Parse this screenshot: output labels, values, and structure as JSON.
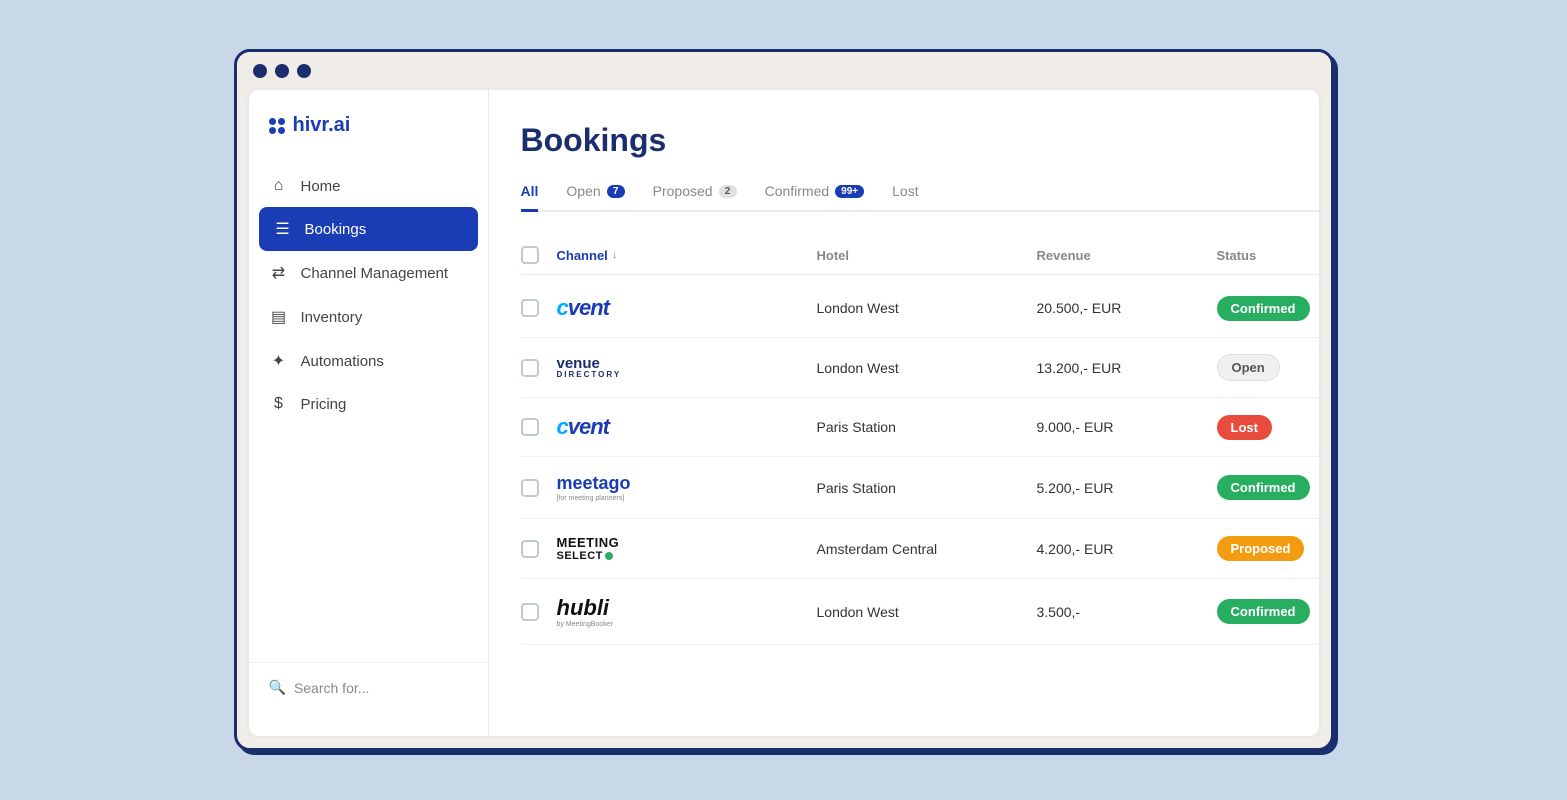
{
  "app": {
    "logo_text": "hivr.ai"
  },
  "sidebar": {
    "nav_items": [
      {
        "id": "home",
        "label": "Home",
        "icon": "home",
        "active": false
      },
      {
        "id": "bookings",
        "label": "Bookings",
        "icon": "bookings",
        "active": true
      },
      {
        "id": "channel-management",
        "label": "Channel Management",
        "icon": "channel",
        "active": false
      },
      {
        "id": "inventory",
        "label": "Inventory",
        "icon": "inventory",
        "active": false
      },
      {
        "id": "automations",
        "label": "Automations",
        "icon": "automations",
        "active": false
      },
      {
        "id": "pricing",
        "label": "Pricing",
        "icon": "pricing",
        "active": false
      }
    ],
    "search_placeholder": "Search for..."
  },
  "main": {
    "page_title": "Bookings",
    "tabs": [
      {
        "id": "all",
        "label": "All",
        "badge": null,
        "active": true
      },
      {
        "id": "open",
        "label": "Open",
        "badge": "7",
        "active": false
      },
      {
        "id": "proposed",
        "label": "Proposed",
        "badge": "2",
        "active": false
      },
      {
        "id": "confirmed",
        "label": "Confirmed",
        "badge": "99+",
        "active": false
      },
      {
        "id": "lost",
        "label": "Lost",
        "badge": null,
        "active": false
      }
    ],
    "table": {
      "columns": [
        {
          "id": "checkbox",
          "label": ""
        },
        {
          "id": "channel",
          "label": "Channel",
          "sortable": true
        },
        {
          "id": "hotel",
          "label": "Hotel"
        },
        {
          "id": "revenue",
          "label": "Revenue"
        },
        {
          "id": "status",
          "label": "Status"
        },
        {
          "id": "actions",
          "label": ""
        }
      ],
      "rows": [
        {
          "id": 1,
          "channel": "cvent",
          "channel_display": "cvent",
          "hotel": "London West",
          "revenue": "20.500,- EUR",
          "status": "Confirmed",
          "status_type": "confirmed"
        },
        {
          "id": 2,
          "channel": "venue-directory",
          "channel_display": "Venue Directory",
          "hotel": "London West",
          "revenue": "13.200,- EUR",
          "status": "Open",
          "status_type": "open"
        },
        {
          "id": 3,
          "channel": "cvent",
          "channel_display": "cvent",
          "hotel": "Paris Station",
          "revenue": "9.000,- EUR",
          "status": "Lost",
          "status_type": "lost"
        },
        {
          "id": 4,
          "channel": "meetago",
          "channel_display": "meetago",
          "hotel": "Paris Station",
          "revenue": "5.200,- EUR",
          "status": "Confirmed",
          "status_type": "confirmed"
        },
        {
          "id": 5,
          "channel": "meeting-select",
          "channel_display": "Meeting Select",
          "hotel": "Amsterdam Central",
          "revenue": "4.200,- EUR",
          "status": "Proposed",
          "status_type": "proposed"
        },
        {
          "id": 6,
          "channel": "hubli",
          "channel_display": "hubli",
          "hotel": "London West",
          "revenue": "3.500,-",
          "status": "Confirmed",
          "status_type": "confirmed"
        }
      ]
    }
  },
  "colors": {
    "primary": "#1a3cb5",
    "confirmed": "#27ae60",
    "open": "#f0f0f0",
    "lost": "#e74c3c",
    "proposed": "#f39c12"
  }
}
